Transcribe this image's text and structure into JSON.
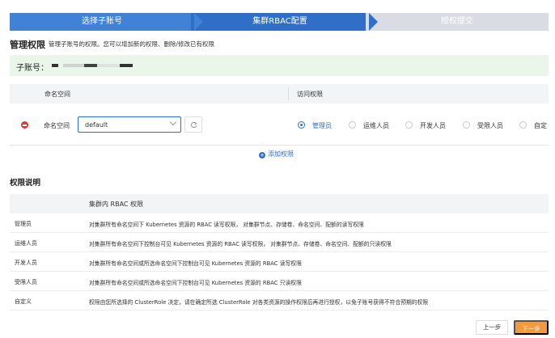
{
  "steps": [
    {
      "label": "选择子账号"
    },
    {
      "label": "集群RBAC配置"
    },
    {
      "label": "授权提交"
    }
  ],
  "header": {
    "title": "管理权限",
    "description": "管理子账号的权限。您可以增加新的权限、删除/修改已有权限"
  },
  "account": {
    "label": "子账号："
  },
  "permissions": {
    "columns": [
      "命名空间",
      "访问权限"
    ],
    "row": {
      "namespace_label": "命名空间",
      "namespace_value": "default"
    },
    "roles": [
      {
        "label": "管理员",
        "checked": true
      },
      {
        "label": "运维人员",
        "checked": false
      },
      {
        "label": "开发人员",
        "checked": false
      },
      {
        "label": "受限人员",
        "checked": false
      },
      {
        "label": "自定",
        "checked": false
      }
    ],
    "add_label": "添加权限"
  },
  "explain": {
    "title": "权限说明",
    "column": "集群内 RBAC 权限",
    "rows": [
      {
        "role": "管理员",
        "desc": "对集群所有命名空间下 Kubernetes 资源的 RBAC 读写权限， 对集群节点、存储卷、命名空间、配额的读写权限"
      },
      {
        "role": "运维人员",
        "desc": "对集群所有命名空间下控制台可见 Kubernetes 资源的 RBAC 读写权限， 对集群节点、存储卷、命名空间、配额的只读权限"
      },
      {
        "role": "开发人员",
        "desc": "对集群所有命名空间或所选命名空间下控制台可见 Kubernetes 资源的 RBAC 读写权限"
      },
      {
        "role": "受限人员",
        "desc": "对集群所有命名空间或所选命名空间下控制台可见 Kubernetes 资源的 RBAC 只读权限"
      },
      {
        "role": "自定义",
        "desc": "权限由您所选择的 ClusterRole 决定，请在确定所选 ClusterRole 对各类资源的操作权限后再进行授权，以免子账号获得不符合预期的权限"
      }
    ]
  },
  "footer": {
    "prev_label": "上一步",
    "next_label": "下一步"
  },
  "colors": {
    "primary": "#2f6fc8",
    "step_active": "#3f82d6",
    "step_inactive": "#d9dde3",
    "danger": "#d93a3a",
    "next_button": "#f39a3d",
    "account_bg": "#eaf6e9"
  }
}
